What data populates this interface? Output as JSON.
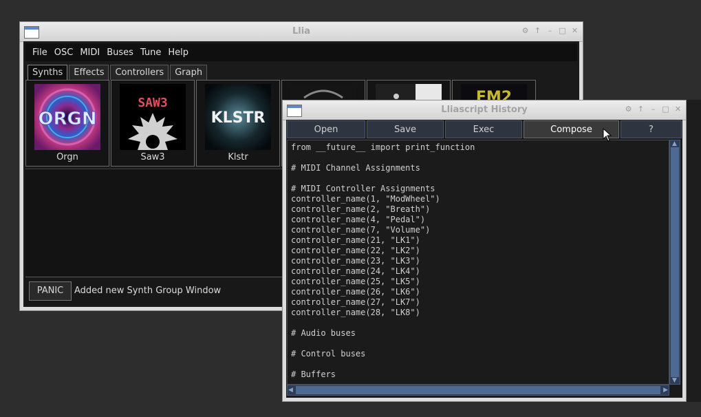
{
  "llia": {
    "title": "Llia",
    "menu": [
      "File",
      "OSC",
      "MIDI",
      "Buses",
      "Tune",
      "Help"
    ],
    "tabs": [
      {
        "label": "Synths",
        "active": true
      },
      {
        "label": "Effects",
        "active": false
      },
      {
        "label": "Controllers",
        "active": false
      },
      {
        "label": "Graph",
        "active": false
      }
    ],
    "synths": [
      {
        "name": "Orgn",
        "logo_text": "ORGN"
      },
      {
        "name": "Saw3",
        "logo_text": "SAW3"
      },
      {
        "name": "Klstr",
        "logo_text": "KLSTR"
      },
      {
        "name": "",
        "logo_text": ""
      },
      {
        "name": "",
        "logo_text": ""
      },
      {
        "name": "",
        "logo_text": "FM2"
      }
    ],
    "panic_label": "PANIC",
    "status": "Added new Synth Group Window"
  },
  "history": {
    "title": "Lliascript History",
    "buttons": {
      "open": "Open",
      "save": "Save",
      "exec": "Exec",
      "compose": "Compose",
      "help": "?"
    },
    "code": "from __future__ import print_function\n\n# MIDI Channel Assignments\n\n# MIDI Controller Assignments\ncontroller_name(1, \"ModWheel\")\ncontroller_name(2, \"Breath\")\ncontroller_name(4, \"Pedal\")\ncontroller_name(7, \"Volume\")\ncontroller_name(21, \"LK1\")\ncontroller_name(22, \"LK2\")\ncontroller_name(23, \"LK3\")\ncontroller_name(24, \"LK4\")\ncontroller_name(25, \"LK5\")\ncontroller_name(26, \"LK6\")\ncontroller_name(27, \"LK7\")\ncontroller_name(28, \"LK8\")\n\n# Audio buses\n\n# Control buses\n\n# Buffers"
  },
  "colors": {
    "desktop": "#2d2d2d",
    "panel": "#1a1a1a",
    "button_blue": "#2f3540",
    "scroll_blue": "#2d3d57"
  },
  "icons": {
    "window_menu": "window-icon",
    "title_buttons": [
      "settings-icon",
      "raise-icon",
      "minimize-icon",
      "maximize-icon",
      "close-icon"
    ]
  }
}
